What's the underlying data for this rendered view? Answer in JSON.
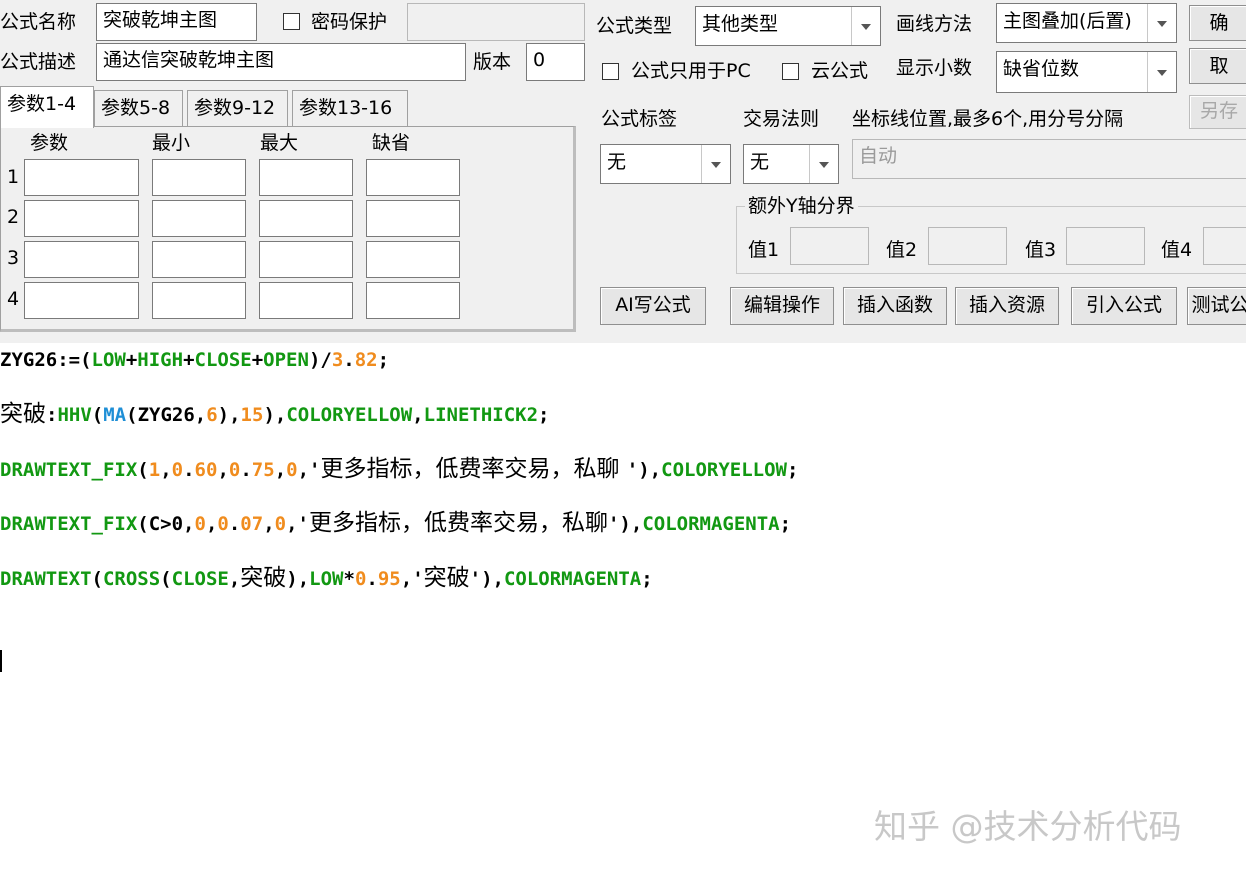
{
  "header": {
    "name_label": "公式名称",
    "name_value": "突破乾坤主图",
    "password_label": "密码保护",
    "desc_label": "公式描述",
    "desc_value": "通达信突破乾坤主图",
    "version_label": "版本",
    "version_value": "0",
    "type_label": "公式类型",
    "type_value": "其他类型",
    "draw_label": "画线方法",
    "draw_value": "主图叠加(后置)",
    "pc_only_label": "公式只用于PC",
    "cloud_label": "云公式",
    "decimals_label": "显示小数",
    "decimals_value": "缺省位数",
    "confirm_button": "确",
    "cancel_button": "取",
    "saveas_button": "另存"
  },
  "tabs": [
    "参数1-4",
    "参数5-8",
    "参数9-12",
    "参数13-16"
  ],
  "params": {
    "columns": [
      "参数",
      "最小",
      "最大",
      "缺省"
    ],
    "rows": [
      "1",
      "2",
      "3",
      "4"
    ]
  },
  "right": {
    "tag_label": "公式标签",
    "tag_value": "无",
    "rule_label": "交易法则",
    "rule_value": "无",
    "axis_label": "坐标线位置,最多6个,用分号分隔",
    "axis_value": "自动",
    "yaxis_group": "额外Y轴分界",
    "values": [
      "值1",
      "值2",
      "值3",
      "值4"
    ]
  },
  "buttons": [
    "AI写公式",
    "编辑操作",
    "插入函数",
    "插入资源",
    "引入公式",
    "测试公"
  ],
  "code_lines": [
    [
      [
        "ZYG26:=(",
        "k"
      ],
      [
        "LOW",
        "g"
      ],
      [
        "+",
        "k"
      ],
      [
        "HIGH",
        "g"
      ],
      [
        "+",
        "k"
      ],
      [
        "CLOSE",
        "g"
      ],
      [
        "+",
        "k"
      ],
      [
        "OPEN",
        "g"
      ],
      [
        ")/",
        "k"
      ],
      [
        "3",
        "o"
      ],
      [
        ".",
        "k"
      ],
      [
        "82",
        "o"
      ],
      [
        ";",
        "k"
      ]
    ],
    [
      [
        "突破",
        "c"
      ],
      [
        ":",
        "k"
      ],
      [
        "HHV",
        "g"
      ],
      [
        "(",
        "k"
      ],
      [
        "MA",
        "b"
      ],
      [
        "(ZYG26,",
        "k"
      ],
      [
        "6",
        "o"
      ],
      [
        "),",
        "k"
      ],
      [
        "15",
        "o"
      ],
      [
        "),",
        "k"
      ],
      [
        "COLORYELLOW",
        "g"
      ],
      [
        ",",
        "k"
      ],
      [
        "LINETHICK2",
        "g"
      ],
      [
        ";",
        "k"
      ]
    ],
    [
      [
        "DRAWTEXT_FIX",
        "g"
      ],
      [
        "(",
        "k"
      ],
      [
        "1",
        "o"
      ],
      [
        ",",
        "k"
      ],
      [
        "0",
        "o"
      ],
      [
        ".",
        "k"
      ],
      [
        "60",
        "o"
      ],
      [
        ",",
        "k"
      ],
      [
        "0",
        "o"
      ],
      [
        ".",
        "k"
      ],
      [
        "75",
        "o"
      ],
      [
        ",",
        "k"
      ],
      [
        "0",
        "o"
      ],
      [
        ",'",
        "k"
      ],
      [
        "更多指标，低费率交易，私聊 ",
        "c"
      ],
      [
        "'),",
        "k"
      ],
      [
        "COLORYELLOW",
        "g"
      ],
      [
        ";",
        "k"
      ]
    ],
    [
      [
        "DRAWTEXT_FIX",
        "g"
      ],
      [
        "(C>0,",
        "k"
      ],
      [
        "0",
        "o"
      ],
      [
        ",",
        "k"
      ],
      [
        "0",
        "o"
      ],
      [
        ".",
        "k"
      ],
      [
        "07",
        "o"
      ],
      [
        ",",
        "k"
      ],
      [
        "0",
        "o"
      ],
      [
        ",'",
        "k"
      ],
      [
        "更多指标，低费率交易，私聊",
        "c"
      ],
      [
        "'),",
        "k"
      ],
      [
        "COLORMAGENTA",
        "g"
      ],
      [
        ";",
        "k"
      ]
    ],
    [
      [
        "DRAWTEXT",
        "g"
      ],
      [
        "(",
        "k"
      ],
      [
        "CROSS",
        "g"
      ],
      [
        "(",
        "k"
      ],
      [
        "CLOSE",
        "g"
      ],
      [
        ",",
        "k"
      ],
      [
        "突破",
        "c"
      ],
      [
        "),",
        "k"
      ],
      [
        "LOW",
        "g"
      ],
      [
        "*",
        "k"
      ],
      [
        "0",
        "o"
      ],
      [
        ".",
        "k"
      ],
      [
        "95",
        "o"
      ],
      [
        ",'",
        "k"
      ],
      [
        "突破",
        "c"
      ],
      [
        "'),",
        "k"
      ],
      [
        "COLORMAGENTA",
        "g"
      ],
      [
        ";",
        "k"
      ]
    ]
  ],
  "code_colors": {
    "k": "#000000",
    "g": "#129812",
    "o": "#f08c1e",
    "b": "#1f8fd6",
    "c": "#000000"
  },
  "watermark": "知乎 @技术分析代码"
}
